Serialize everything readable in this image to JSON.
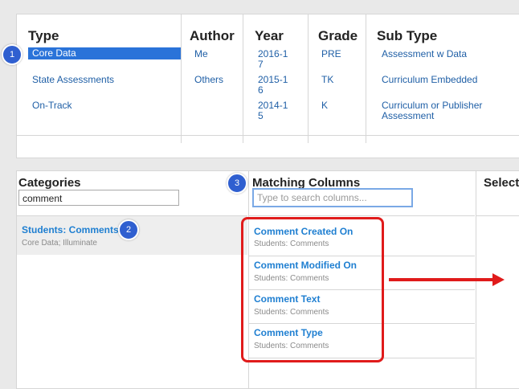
{
  "filters": {
    "type": {
      "header": "Type",
      "items": [
        "Core Data",
        "State Assessments",
        "On-Track"
      ]
    },
    "author": {
      "header": "Author",
      "items": [
        "Me",
        "Others"
      ]
    },
    "year": {
      "header": "Year",
      "items": [
        "2016-17",
        "2015-16",
        "2014-15"
      ]
    },
    "grade": {
      "header": "Grade",
      "items": [
        "PRE",
        "TK",
        "K"
      ]
    },
    "subtype": {
      "header": "Sub Type",
      "items": [
        "Assessment w Data",
        "Curriculum Embedded",
        "Curriculum or Publisher Assessment"
      ]
    }
  },
  "categories": {
    "label": "Categories",
    "search_value": "comment",
    "items": [
      {
        "title": "Students: Comments",
        "sub": "Core Data; Illuminate"
      }
    ]
  },
  "matching": {
    "label": "Matching Columns",
    "placeholder": "Type to search columns...",
    "items": [
      {
        "title": "Comment Created On",
        "sub": "Students: Comments"
      },
      {
        "title": "Comment Modified On",
        "sub": "Students: Comments"
      },
      {
        "title": "Comment Text",
        "sub": "Students: Comments"
      },
      {
        "title": "Comment Type",
        "sub": "Students: Comments"
      }
    ]
  },
  "selected": {
    "label": "Select"
  },
  "badges": {
    "one": "1",
    "two": "2",
    "three": "3"
  },
  "colors": {
    "accent": "#2a73d9",
    "badge": "#2f5fd0",
    "annotation": "#e01b1b"
  }
}
